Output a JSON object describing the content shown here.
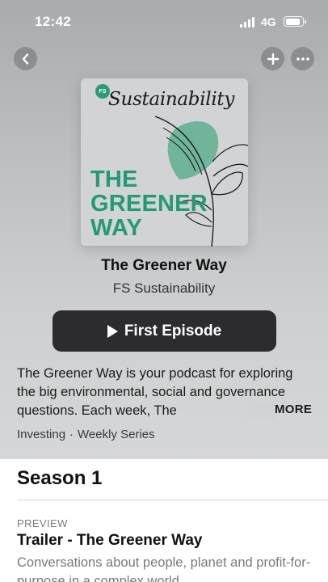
{
  "status_bar": {
    "time": "12:42",
    "network": "4G"
  },
  "nav": {
    "back_icon": "chevron-left-icon",
    "add_icon": "plus-icon",
    "more_icon": "ellipsis-icon"
  },
  "artwork": {
    "logo": "FS",
    "brand": "Sustainability",
    "title_lines": [
      "THE",
      "GREENER",
      "WAY"
    ],
    "accent_color": "#239a77"
  },
  "podcast": {
    "title": "The Greener Way",
    "author": "FS Sustainability",
    "play_label": "First Episode",
    "description": "The Greener Way is your podcast for exploring the big environmental, social and governance questions. Each week, The",
    "more_label": "MORE",
    "category": "Investing",
    "separator": "·",
    "frequency": "Weekly Series"
  },
  "season": {
    "title": "Season 1",
    "episodes": [
      {
        "label": "PREVIEW",
        "title": "Trailer - The Greener Way",
        "description": "Conversations about people, planet and profit-for-purpose in a complex world."
      }
    ]
  }
}
